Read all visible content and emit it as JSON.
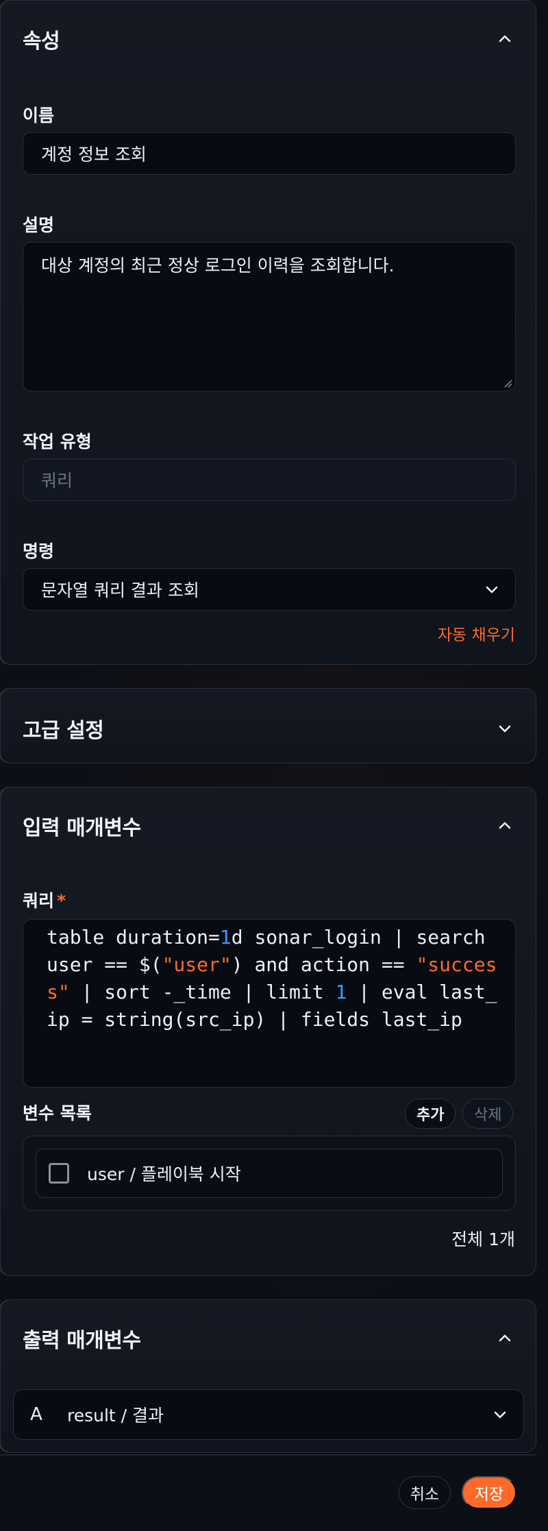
{
  "properties": {
    "title": "속성",
    "name_label": "이름",
    "name_value": "계정 정보 조회",
    "desc_label": "설명",
    "desc_value": "대상 계정의 최근 정상 로그인 이력을 조회합니다.",
    "task_type_label": "작업 유형",
    "task_type_value": "쿼리",
    "command_label": "명령",
    "command_value": "문자열 쿼리 결과 조회",
    "autofill_label": "자동 채우기"
  },
  "advanced": {
    "title": "고급 설정"
  },
  "input_params": {
    "title": "입력 매개변수",
    "query_label": "쿼리",
    "required_mark": "*",
    "query_parts": {
      "p1": "table duration=",
      "n1": "1",
      "p2": "d sonar_login | search user == $(",
      "s1": "\"user\"",
      "p3": ") and action == ",
      "s2": "\"success\"",
      "p4": " | sort -_time | limit ",
      "n2": "1",
      "p5": " | eval last_ip = string(src_ip) | fields last_ip"
    },
    "var_list_label": "변수 목록",
    "add_button": "추가",
    "delete_button": "삭제",
    "variables": [
      {
        "label": "user / 플레이북 시작",
        "checked": false
      }
    ],
    "total": "전체 1개"
  },
  "output_params": {
    "title": "출력 매개변수",
    "items": [
      {
        "type_glyph": "A",
        "label": "result / 결과"
      }
    ]
  },
  "footer": {
    "cancel": "취소",
    "save": "저장"
  },
  "colors": {
    "accent": "#ff6a2b",
    "number_token": "#3b9bff"
  },
  "icons": {
    "collapse": "chevron-up-icon",
    "expand": "chevron-down-icon"
  }
}
